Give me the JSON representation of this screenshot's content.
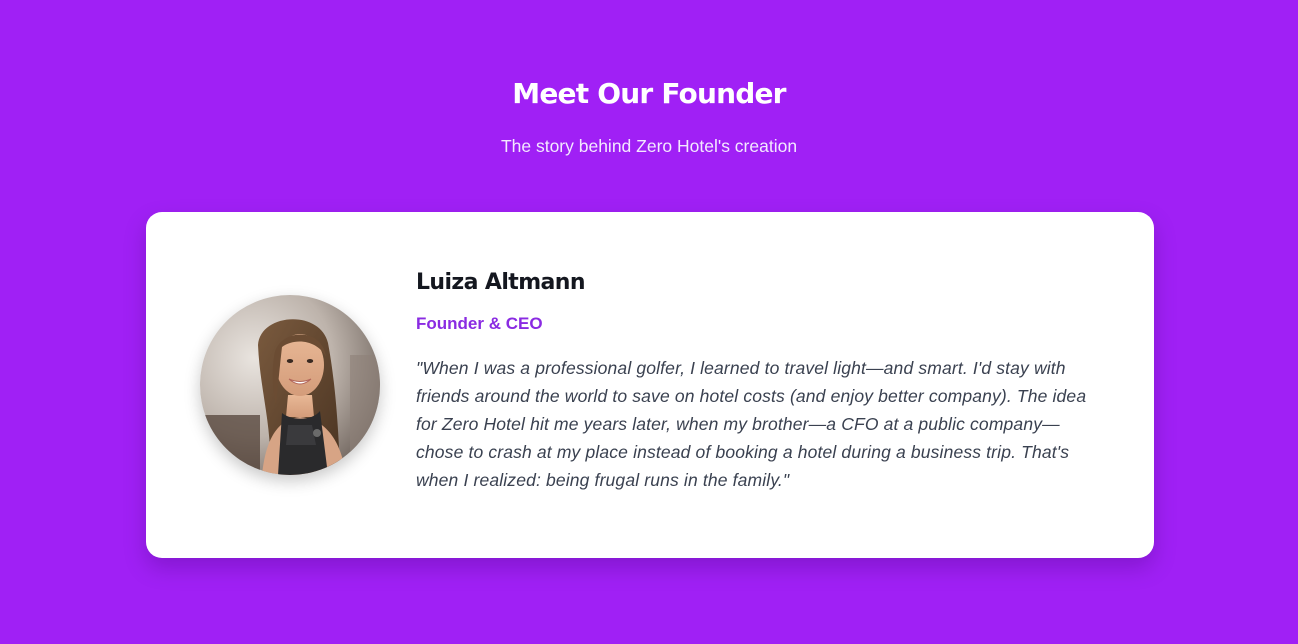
{
  "header": {
    "title": "Meet Our Founder",
    "subtitle": "The story behind Zero Hotel's creation"
  },
  "founder": {
    "name": "Luiza Altmann",
    "role": "Founder & CEO",
    "quote": "\"When I was a professional golfer, I learned to travel light—and smart. I'd stay with friends around the world to save on hotel costs (and enjoy better company). The idea for Zero Hotel hit me years later, when my brother—a CFO at a public company—chose to crash at my place instead of booking a hotel during a business trip. That's when I realized: being frugal runs in the family.\""
  },
  "colors": {
    "background": "#a020f5",
    "card": "#ffffff",
    "accent": "#8a2be2",
    "name_text": "#14171f",
    "quote_text": "#3a4150"
  }
}
